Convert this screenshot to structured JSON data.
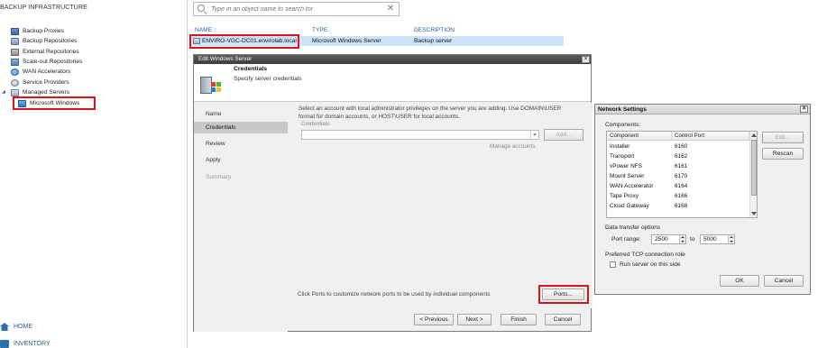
{
  "sidebar": {
    "header": "BACKUP INFRASTRUCTURE",
    "items": [
      {
        "label": "Backup Proxies",
        "icon": "proxy-icon"
      },
      {
        "label": "Backup Repositories",
        "icon": "repository-icon"
      },
      {
        "label": "External Repositories",
        "icon": "external-repository-icon"
      },
      {
        "label": "Scale-out Repositories",
        "icon": "scaleout-repository-icon"
      },
      {
        "label": "WAN Accelerators",
        "icon": "wan-accelerator-icon"
      },
      {
        "label": "Service Providers",
        "icon": "service-provider-icon"
      },
      {
        "label": "Managed Servers",
        "icon": "managed-servers-icon"
      },
      {
        "label": "Microsoft Windows",
        "icon": "windows-icon"
      }
    ],
    "nav": {
      "home": "HOME",
      "inventory": "INVENTORY"
    }
  },
  "search": {
    "placeholder": "Type in an object name to search for"
  },
  "list": {
    "columns": {
      "name": "NAME ↑",
      "type": "TYPE",
      "description": "DESCRIPTION"
    },
    "rows": [
      {
        "name": "ENVIRO-VGC-DC01.envirolab.local",
        "type": "Microsoft Windows Server",
        "description": "Backup server"
      }
    ]
  },
  "edit_dialog": {
    "title": "Edit Windows Server",
    "header_title": "Credentials",
    "header_subtitle": "Specify server credentials",
    "steps": [
      "Name",
      "Credentials",
      "Review",
      "Apply",
      "Summary"
    ],
    "description": "Select an account with local administrator privileges on the server you are adding. Use DOMAIN\\USER format for domain accounts, or HOST\\USER for local accounts.",
    "credentials_label": "Credentials:",
    "credentials_value": "",
    "add_button": "Add...",
    "manage_accounts": "Manage accounts",
    "ports_hint": "Click Ports to customize network ports to be used by individual components",
    "ports_button": "Ports...",
    "buttons": {
      "previous": "< Previous",
      "next": "Next >",
      "finish": "Finish",
      "cancel": "Cancel"
    }
  },
  "network_dialog": {
    "title": "Network Settings",
    "components_label": "Components:",
    "table_headers": {
      "component": "Component",
      "port": "Control Port"
    },
    "components": [
      {
        "name": "Installer",
        "port": "6160"
      },
      {
        "name": "Transport",
        "port": "6162"
      },
      {
        "name": "vPower NFS",
        "port": "6161"
      },
      {
        "name": "Mount Server",
        "port": "6170"
      },
      {
        "name": "WAN Accelerator",
        "port": "6164"
      },
      {
        "name": "Tape Proxy",
        "port": "6166"
      },
      {
        "name": "Cloud Gateway",
        "port": "6168"
      }
    ],
    "edit_button": "Edit...",
    "rescan_button": "Rescan",
    "data_transfer_label": "Data transfer options",
    "port_range_label": "Port range:",
    "port_from": "2500",
    "to_label": "to",
    "port_to": "5000",
    "preferred_label": "Preferred TCP connection role",
    "run_server_label": "Run server on this side",
    "run_server_checked": false,
    "ok_button": "OK",
    "cancel_button": "Cancel"
  },
  "colors": {
    "selection": "#cde3f7",
    "highlight_box": "#d9141b",
    "link": "#2a5d9c"
  }
}
